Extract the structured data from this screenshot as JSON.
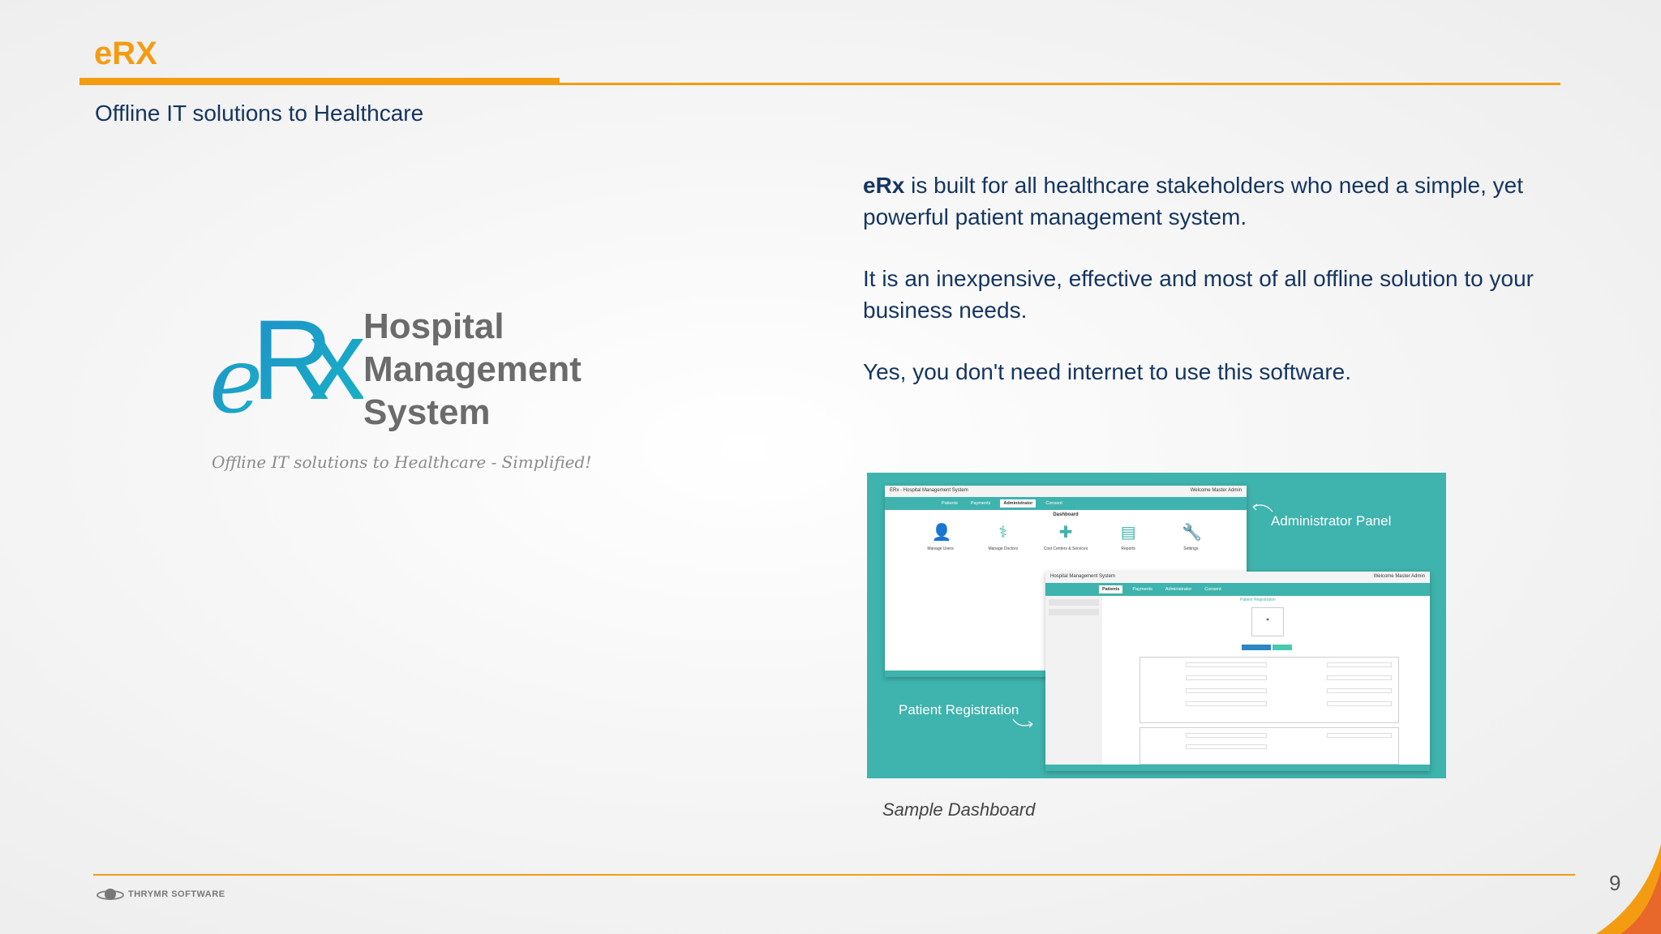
{
  "header": {
    "app_title": "eRX",
    "subtitle": "Offline IT solutions to Healthcare"
  },
  "logo": {
    "mark_e": "e",
    "mark_rx": "Rx",
    "line1": "Hospital",
    "line2": "Management",
    "line3": "System",
    "tagline": "Offline IT solutions to Healthcare - Simplified!"
  },
  "description": {
    "p1_bold": "eRx",
    "p1_rest": " is built for all healthcare stakeholders who need a simple, yet powerful patient management system.",
    "p2": "It is an inexpensive, effective and most of all offline solution to your business needs.",
    "p3": "Yes, you don't need internet to use this software."
  },
  "dashboard_image": {
    "admin_window_title": "ERx - Hospital Management System",
    "welcome": "Welcome Master Admin",
    "nav": [
      "Patients",
      "Payments",
      "Administrator",
      "Consent"
    ],
    "dashboard_label": "Dashboard",
    "icons": [
      {
        "name": "user-icon",
        "glyph": "👤",
        "caption": "Manage Users"
      },
      {
        "name": "doctor-icon",
        "glyph": "⚕",
        "caption": "Manage Doctors"
      },
      {
        "name": "medkit-icon",
        "glyph": "✚",
        "caption": "Cost Centers & Services"
      },
      {
        "name": "document-icon",
        "glyph": "▤",
        "caption": "Reports"
      },
      {
        "name": "wrench-icon",
        "glyph": "🔧",
        "caption": "Settings"
      }
    ],
    "reg_window_title": "Hospital Management System",
    "reg_heading": "Patient Registration",
    "admin_label": "Administrator Panel",
    "patient_label": "Patient Registration",
    "caption": "Sample Dashboard"
  },
  "footer": {
    "company": "THRYMR SOFTWARE",
    "page_number": "9"
  },
  "colors": {
    "accent": "#f39c12",
    "navy": "#15355f",
    "teal": "#3fb3ad",
    "logo_blue": "#1e90c8"
  }
}
